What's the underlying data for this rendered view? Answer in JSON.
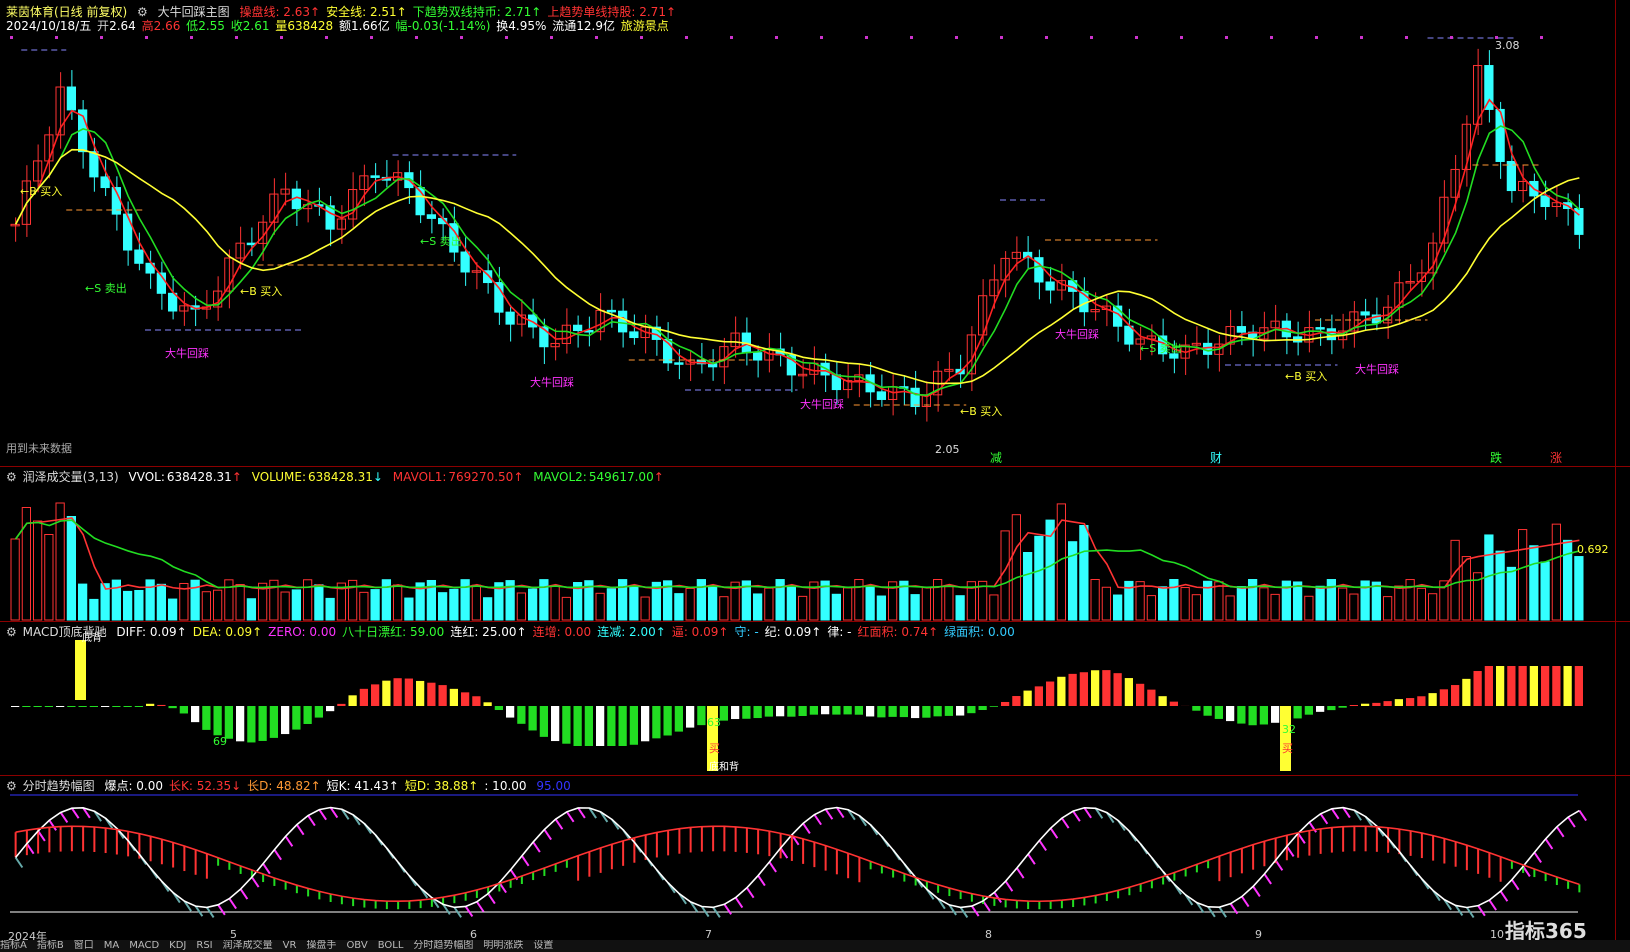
{
  "main": {
    "stock_name": "莱茵体育(日线 前复权)",
    "indicator_name": "大牛回踩主图",
    "lines": [
      {
        "label": "操盘线:",
        "value": "2.63",
        "arrow": "↑",
        "color": "#ff3333"
      },
      {
        "label": "安全线:",
        "value": "2.51",
        "arrow": "↑",
        "color": "#ffff33"
      },
      {
        "label": "下趋势双线持币:",
        "value": "2.71",
        "arrow": "↑",
        "color": "#33ff33"
      },
      {
        "label": "上趋势单线持股:",
        "value": "2.71",
        "arrow": "↑",
        "color": "#ff3333"
      }
    ],
    "quote": {
      "date": "2024/10/18/五",
      "open_label": "开",
      "open": "2.64",
      "high_label": "高",
      "high": "2.66",
      "low_label": "低",
      "low": "2.55",
      "close_label": "收",
      "close": "2.61",
      "vol_label": "量",
      "vol": "638428",
      "amt_label": "额",
      "amt": "1.66亿",
      "chg_label": "幅",
      "chg": "-0.03(-1.14%)",
      "turn_label": "换",
      "turn": "4.95%",
      "float_label": "流通",
      "float": "12.9亿",
      "sector": "旅游景点"
    },
    "future_note": "用到未来数据",
    "labels": {
      "b_buy": "←B 买入",
      "s_sell": "←S 卖出",
      "bull": "大牛回踩",
      "high_mark": "3.08",
      "low_mark": "2.05",
      "events": [
        "减",
        "财",
        "跌",
        "涨"
      ]
    }
  },
  "volume": {
    "name": "润泽成交量(3,13)",
    "vvol_label": "VVOL:",
    "vvol": "638428.31",
    "vvol_arrow": "↑",
    "volume_label": "VOLUME:",
    "volume": "638428.31",
    "volume_arrow": "↓",
    "mavol1_label": "MAVOL1:",
    "mavol1": "769270.50",
    "mavol1_arrow": "↑",
    "mavol2_label": "MAVOL2:",
    "mavol2": "549617.00",
    "mavol2_arrow": "↑",
    "right_label": "0.692"
  },
  "macd": {
    "name": "MACD顶底背驰",
    "items": [
      {
        "label": "DIFF:",
        "value": "0.09",
        "arrow": "↑",
        "color": "#ffffff"
      },
      {
        "label": "DEA:",
        "value": "0.09",
        "arrow": "↑",
        "color": "#ffff33"
      },
      {
        "label": "ZERO:",
        "value": "0.00",
        "arrow": "",
        "color": "#ff33ff"
      },
      {
        "label": "八十日漂红:",
        "value": "59.00",
        "arrow": "",
        "color": "#33ff33"
      },
      {
        "label": "连红:",
        "value": "25.00",
        "arrow": "↑",
        "color": "#ffffff"
      },
      {
        "label": "连增:",
        "value": "0.00",
        "arrow": "",
        "color": "#ff3333"
      },
      {
        "label": "连减:",
        "value": "2.00",
        "arrow": "↑",
        "color": "#33ffff"
      },
      {
        "label": "逼:",
        "value": "0.09",
        "arrow": "↑",
        "color": "#ff3333"
      },
      {
        "label": "守:",
        "value": "-",
        "arrow": "",
        "color": "#33ccff"
      },
      {
        "label": "纪:",
        "value": "0.09",
        "arrow": "↑",
        "color": "#ffffff"
      },
      {
        "label": "律:",
        "value": "-",
        "arrow": "",
        "color": "#ffffff"
      },
      {
        "label": "红面积:",
        "value": "0.74",
        "arrow": "↑",
        "color": "#ff3333"
      },
      {
        "label": "绿面积:",
        "value": "0.00",
        "arrow": "",
        "color": "#33ccff"
      }
    ],
    "marks": {
      "n69": "69",
      "n63": "63",
      "n32": "32",
      "buy": "买",
      "bottom": "底背",
      "bottom2": "底和背"
    }
  },
  "trend": {
    "name": "分时趋势幅图",
    "items": [
      {
        "label": "爆点:",
        "value": "0.00",
        "arrow": "",
        "color": "#ffffff"
      },
      {
        "label": "长K:",
        "value": "52.35",
        "arrow": "↓",
        "color": "#ff3333"
      },
      {
        "label": "长D:",
        "value": "48.82",
        "arrow": "↑",
        "color": "#ff9933"
      },
      {
        "label": "短K:",
        "value": "41.43",
        "arrow": "↑",
        "color": "#ffffff"
      },
      {
        "label": "短D:",
        "value": "38.88",
        "arrow": "↑",
        "color": "#ffff33"
      },
      {
        "label": ":",
        "value": "10.00",
        "arrow": "",
        "color": "#ffffff"
      },
      {
        "label": "",
        "value": "95.00",
        "arrow": "",
        "color": "#3333ff"
      }
    ]
  },
  "x_axis": [
    "2024年",
    "5",
    "6",
    "7",
    "8",
    "9",
    "10"
  ],
  "bottom_tabs": [
    "指标A",
    "指标B",
    "窗口",
    "MA",
    "MACD",
    "KDJ",
    "RSI",
    "润泽成交量",
    "VR",
    "操盘手",
    "OBV",
    "BOLL",
    "分时趋势幅图",
    "明明涨跌",
    "设置"
  ],
  "logo": "指标365",
  "colors": {
    "up": "#ff3333",
    "down": "#33ffff",
    "ma_red": "#ff2222",
    "ma_green": "#22dd22",
    "ma_yellow": "#ffff33",
    "dash": "#ff9933",
    "purple": "#cc33cc"
  }
}
